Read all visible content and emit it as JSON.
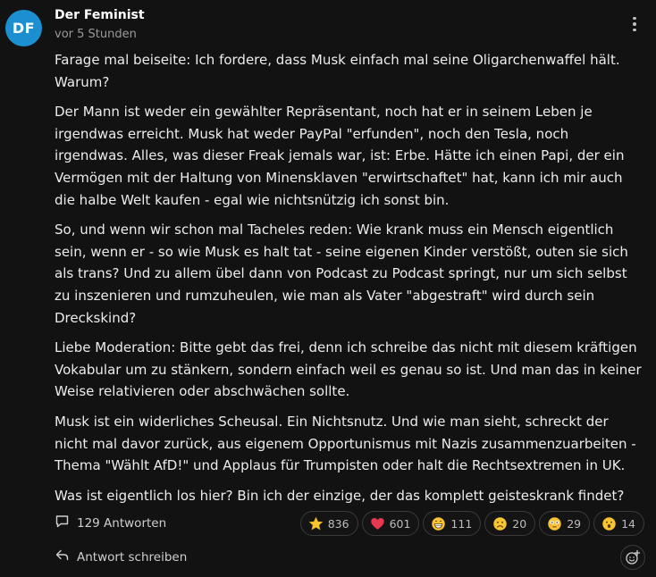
{
  "comment": {
    "avatar_initials": "DF",
    "avatar_color": "#1b8fcf",
    "author": "Der Feminist",
    "timestamp": "vor 5 Stunden",
    "paragraphs": [
      "Farage mal beiseite: Ich fordere, dass Musk einfach mal seine Oligarchenwaffel hält. Warum?",
      "Der Mann ist weder ein gewählter Repräsentant, noch hat er in seinem Leben je irgendwas erreicht. Musk hat weder PayPal \"erfunden\", noch den Tesla, noch irgendwas. Alles, was dieser Freak jemals war, ist: Erbe. Hätte ich einen Papi, der ein Vermögen mit der Haltung von Minensklaven \"erwirtschaftet\" hat, kann ich mir auch die halbe Welt kaufen - egal wie nichtsnützig ich sonst bin.",
      "So, und wenn wir schon mal Tacheles reden: Wie krank muss ein Mensch eigentlich sein, wenn er - so wie Musk es halt tat - seine eigenen Kinder verstößt, outen sie sich als trans? Und zu allem übel dann von Podcast zu Podcast springt, nur um sich selbst zu inszenieren und rumzuheulen, wie man als Vater \"abgestraft\" wird durch sein Dreckskind?",
      "Liebe Moderation: Bitte gebt das frei, denn ich schreibe das nicht mit diesem kräftigen Vokabular um zu stänkern, sondern einfach weil es genau so ist. Und man das in keiner Weise relativieren oder abschwächen sollte.",
      "Musk ist ein widerliches Scheusal. Ein Nichtsnutz. Und wie man sieht, schreckt der nicht mal davor zurück, aus eigenem Opportunismus mit Nazis zusammenzuarbeiten - Thema \"Wählt AfD!\" und Applaus für Trumpisten oder halt die Rechtsextremen in UK.",
      "Was ist eigentlich los hier? Bin ich der einzige, der das komplett geisteskrank findet?"
    ]
  },
  "actions": {
    "replies_label": "129 Antworten",
    "reply_label": "Antwort schreiben",
    "reactions": [
      {
        "name": "star",
        "icon": "star-icon",
        "count": "836"
      },
      {
        "name": "heart",
        "icon": "heart-icon",
        "count": "601"
      },
      {
        "name": "grin",
        "icon": "grinning-face-icon",
        "count": "111"
      },
      {
        "name": "frown",
        "icon": "frowning-face-icon",
        "count": "20"
      },
      {
        "name": "flushed",
        "icon": "flushed-face-icon",
        "count": "29"
      },
      {
        "name": "surprised",
        "icon": "surprised-face-icon",
        "count": "14"
      }
    ]
  }
}
